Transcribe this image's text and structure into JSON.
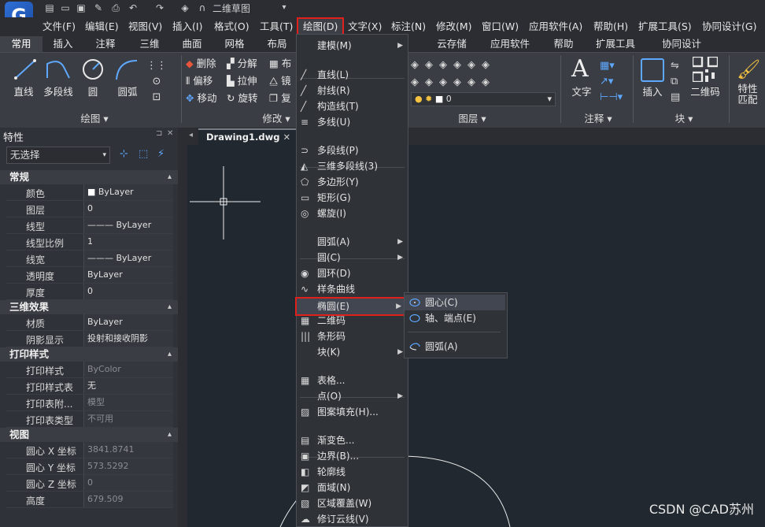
{
  "title_bar": {
    "logo_text": "G",
    "doc_name": "二维草图"
  },
  "menu_bar": [
    "文件(F)",
    "编辑(E)",
    "视图(V)",
    "插入(I)",
    "格式(O)",
    "工具(T)",
    "绘图(D)",
    "文字(X)",
    "标注(N)",
    "修改(M)",
    "窗口(W)",
    "应用软件(A)",
    "帮助(H)",
    "扩展工具(S)",
    "协同设计(G)"
  ],
  "ribbon_tabs": [
    "常用",
    "插入",
    "注释",
    "三维",
    "曲面",
    "网格",
    "布局",
    "云存储",
    "应用软件",
    "帮助",
    "扩展工具",
    "协同设计"
  ],
  "ribbon": {
    "draw_buttons": [
      "直线",
      "多段线",
      "圆",
      "圆弧"
    ],
    "modify_buttons": [
      "删除",
      "分解",
      "偏移",
      "拉伸",
      "移动",
      "旋转"
    ],
    "modify_extra": [
      "布",
      "镜",
      "复"
    ],
    "layer_value": "0",
    "annot_button": "文字",
    "block_buttons": [
      "插入",
      "二维码"
    ],
    "match_button": "特性匹配",
    "panels": {
      "draw": "绘图",
      "modify": "修改",
      "layers": "图层",
      "annot": "注释",
      "block": "块"
    }
  },
  "properties": {
    "title": "特性",
    "selector": "无选择",
    "sections": [
      {
        "name": "常规",
        "rows": [
          {
            "key": "颜色",
            "value": "ByLayer"
          },
          {
            "key": "图层",
            "value": "0"
          },
          {
            "key": "线型",
            "value": "——— ByLayer"
          },
          {
            "key": "线型比例",
            "value": "1"
          },
          {
            "key": "线宽",
            "value": "——— ByLayer"
          },
          {
            "key": "透明度",
            "value": "ByLayer"
          },
          {
            "key": "厚度",
            "value": "0"
          }
        ]
      },
      {
        "name": "三维效果",
        "rows": [
          {
            "key": "材质",
            "value": "ByLayer"
          },
          {
            "key": "阴影显示",
            "value": "投射和接收阴影"
          }
        ]
      },
      {
        "name": "打印样式",
        "rows": [
          {
            "key": "打印样式",
            "value": "ByColor"
          },
          {
            "key": "打印样式表",
            "value": "无"
          },
          {
            "key": "打印表附...",
            "value": "模型"
          },
          {
            "key": "打印表类型",
            "value": "不可用"
          }
        ]
      },
      {
        "name": "视图",
        "rows": [
          {
            "key": "圆心 X 坐标",
            "value": "3841.8741"
          },
          {
            "key": "圆心 Y 坐标",
            "value": "573.5292"
          },
          {
            "key": "圆心 Z 坐标",
            "value": "0"
          },
          {
            "key": "高度",
            "value": "679.509"
          }
        ]
      }
    ]
  },
  "doc_tab": "Drawing1.dwg",
  "draw_menu": {
    "items": [
      "建模(M)",
      "直线(L)",
      "射线(R)",
      "构造线(T)",
      "多线(U)",
      "多段线(P)",
      "三维多段线(3)",
      "多边形(Y)",
      "矩形(G)",
      "螺旋(I)",
      "圆弧(A)",
      "圆(C)",
      "圆环(D)",
      "样条曲线",
      "椭圆(E)",
      "二维码",
      "条形码",
      "块(K)",
      "表格...",
      "点(O)",
      "图案填充(H)...",
      "渐变色...",
      "边界(B)...",
      "轮廓线",
      "面域(N)",
      "区域覆盖(W)",
      "修订云线(V)"
    ]
  },
  "ellipse_submenu": [
    "圆心(C)",
    "轴、端点(E)",
    "圆弧(A)"
  ],
  "watermark": "CSDN @CAD苏州",
  "colors": {
    "highlight_red": "#e0201b",
    "canvas": "#212830",
    "menu_bg": "#2f3237"
  }
}
